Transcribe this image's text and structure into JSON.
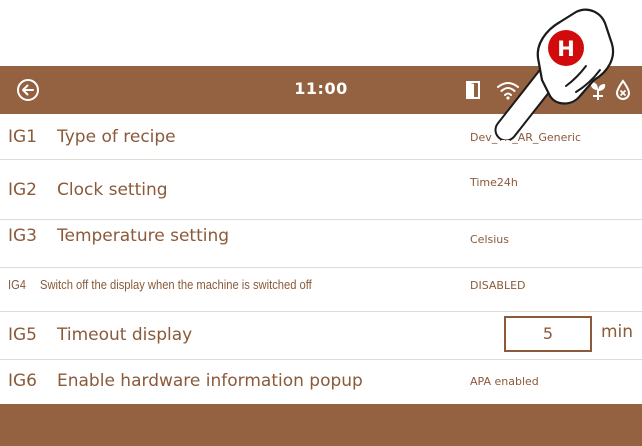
{
  "header": {
    "time": "11:00",
    "back_icon": "arrow-left-circle-icon",
    "status_icons": [
      "door-icon",
      "wifi-icon",
      "plant-icon",
      "water-drop-icon"
    ]
  },
  "settings": [
    {
      "code": "IG1",
      "label": "Type of recipe",
      "value": "Dev_TN_AR_Generic"
    },
    {
      "code": "IG2",
      "label": "Clock setting",
      "value": "Time24h"
    },
    {
      "code": "IG3",
      "label": "Temperature setting",
      "value": "Celsius"
    },
    {
      "code": "IG4",
      "label": "Switch off the display when the machine is switched off",
      "value": "DISABLED"
    },
    {
      "code": "IG5",
      "label": "Timeout display",
      "value": "5",
      "unit": "min"
    },
    {
      "code": "IG6",
      "label": "Enable hardware information popup",
      "value": "APA enabled"
    }
  ],
  "overlay": {
    "badge_letter": "H",
    "icon": "pointing-hand-icon"
  },
  "colors": {
    "bar": "#946241",
    "text": "#8a5a3a",
    "badge": "#d10b0b"
  }
}
